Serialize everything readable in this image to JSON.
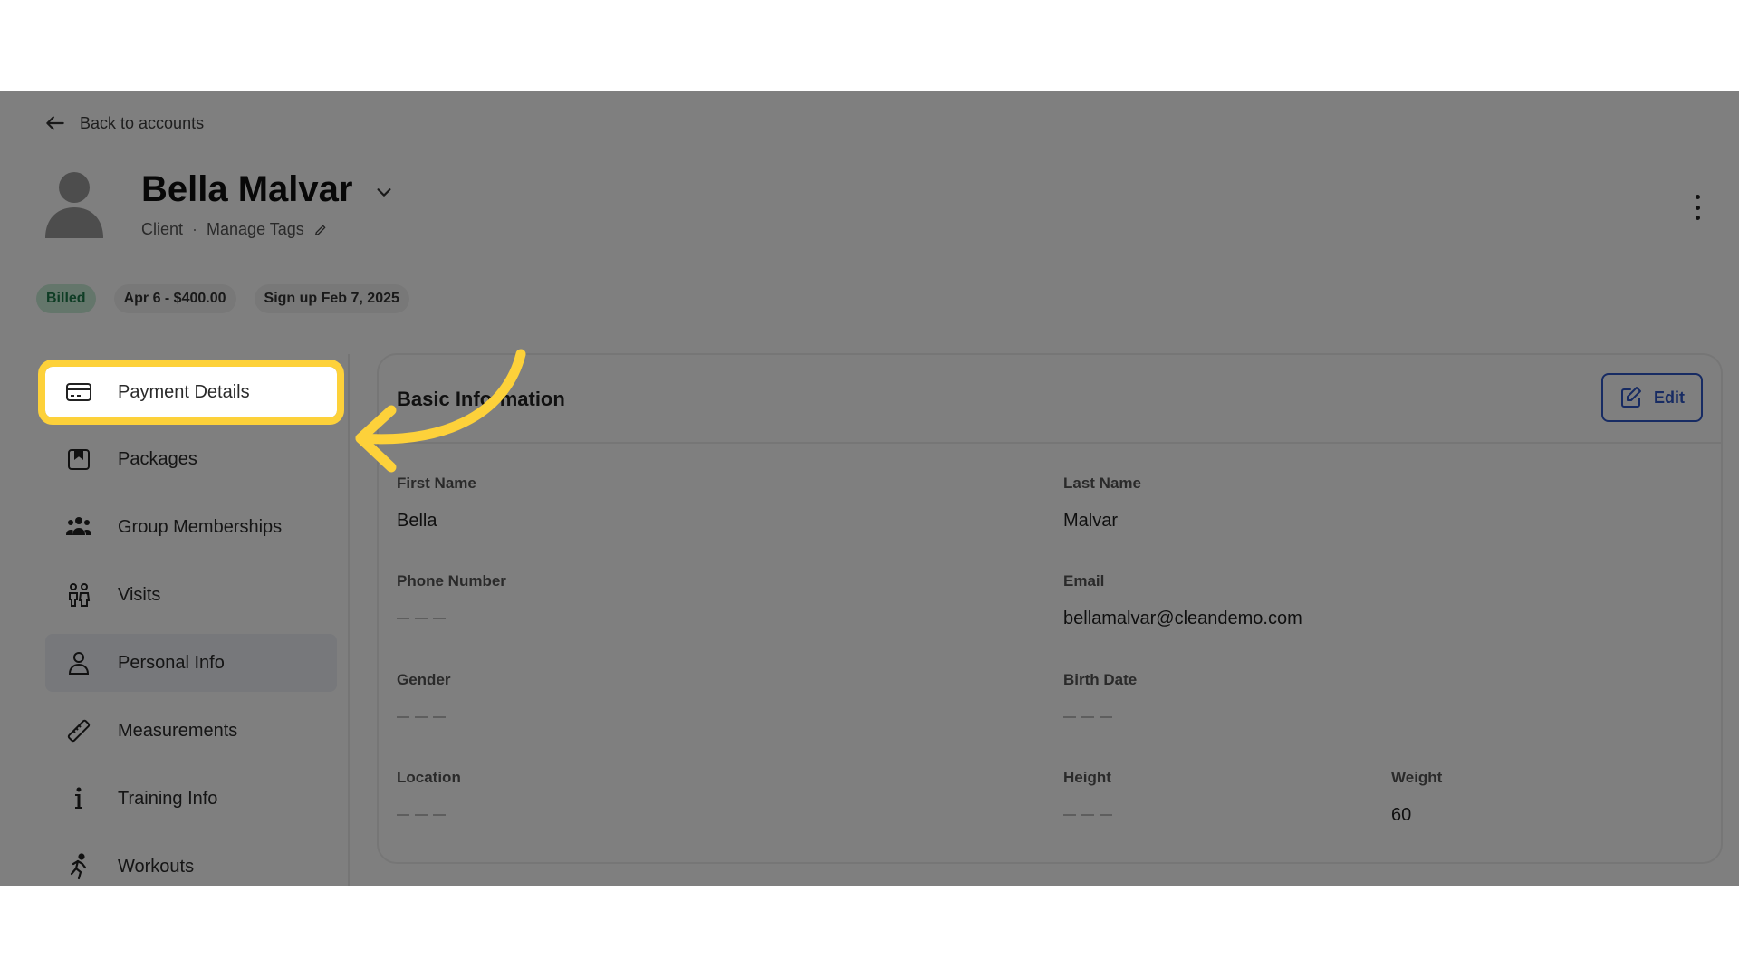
{
  "nav": {
    "back_label": "Back to accounts"
  },
  "profile": {
    "name": "Bella Malvar",
    "role": "Client",
    "separator": "·",
    "manage_tags": "Manage Tags"
  },
  "badges": {
    "billed": "Billed",
    "next_payment": "Apr 6 - $400.00",
    "signup": "Sign up Feb 7, 2025"
  },
  "sidebar": {
    "items": [
      {
        "label": "Payment Details",
        "icon": "credit-card-icon"
      },
      {
        "label": "Packages",
        "icon": "package-icon"
      },
      {
        "label": "Group Memberships",
        "icon": "group-icon"
      },
      {
        "label": "Visits",
        "icon": "visits-icon"
      },
      {
        "label": "Personal Info",
        "icon": "person-icon"
      },
      {
        "label": "Measurements",
        "icon": "ruler-icon"
      },
      {
        "label": "Training Info",
        "icon": "info-icon"
      },
      {
        "label": "Workouts",
        "icon": "running-icon"
      }
    ],
    "active_item": "Personal Info",
    "highlighted_item": "Payment Details"
  },
  "card": {
    "title": "Basic Information",
    "edit_label": "Edit",
    "fields": {
      "first_name": {
        "label": "First Name",
        "value": "Bella"
      },
      "last_name": {
        "label": "Last Name",
        "value": "Malvar"
      },
      "phone": {
        "label": "Phone Number",
        "value": ""
      },
      "email": {
        "label": "Email",
        "value": "bellamalvar@cleandemo.com"
      },
      "gender": {
        "label": "Gender",
        "value": ""
      },
      "birth_date": {
        "label": "Birth Date",
        "value": ""
      },
      "location": {
        "label": "Location",
        "value": ""
      },
      "height": {
        "label": "Height",
        "value": ""
      },
      "weight": {
        "label": "Weight",
        "value": "60"
      }
    }
  },
  "colors": {
    "highlight": "#fdd13a",
    "accent": "#2f56c6",
    "billed_bg": "#c8ecd7",
    "billed_text": "#1e7a4a"
  }
}
